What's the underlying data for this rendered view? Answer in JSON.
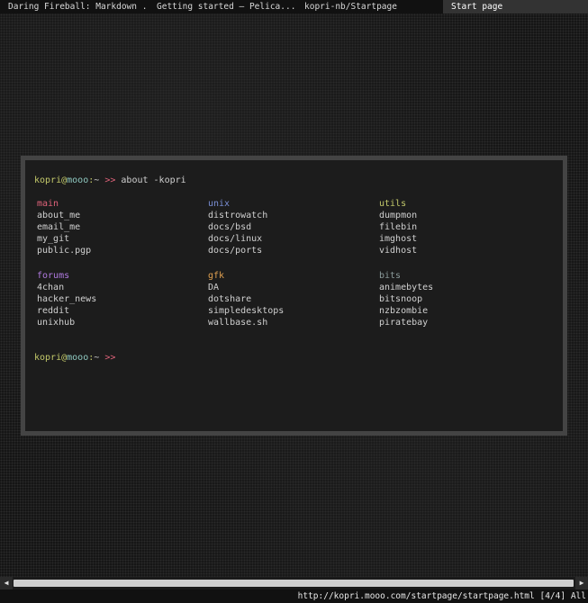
{
  "tabs": [
    {
      "label": "Daring Fireball: Markdown ..."
    },
    {
      "label": "Getting started — Pelica..."
    },
    {
      "label": "kopri-nb/Startpage"
    },
    {
      "label": "Start page"
    }
  ],
  "terminal": {
    "prompt": {
      "user": "kopri",
      "at": "@",
      "host": "mooo",
      "colon": ":",
      "dir": "~",
      "arrow": ">>"
    },
    "command": "about -kopri",
    "sections": [
      {
        "title": "main",
        "color": "#e0637a",
        "links": [
          "about_me",
          "email_me",
          "my_git",
          "public.pgp"
        ]
      },
      {
        "title": "unix",
        "color": "#7a8fd6",
        "links": [
          "distrowatch",
          "docs/bsd",
          "docs/linux",
          "docs/ports"
        ]
      },
      {
        "title": "utils",
        "color": "#c3c96a",
        "links": [
          "dumpmon",
          "filebin",
          "imghost",
          "vidhost"
        ]
      },
      {
        "title": "forums",
        "color": "#b07ae0",
        "links": [
          "4chan",
          "hacker_news",
          "reddit",
          "unixhub"
        ]
      },
      {
        "title": "gfk",
        "color": "#e0a050",
        "links": [
          "DA",
          "dotshare",
          "simpledesktops",
          "wallbase.sh"
        ]
      },
      {
        "title": "bits",
        "color": "#8a9a9a",
        "links": [
          "animebytes",
          "bitsnoop",
          "nzbzombie",
          "piratebay"
        ]
      }
    ]
  },
  "scrollbar": {
    "left_arrow": "◀",
    "right_arrow": "▶"
  },
  "status": {
    "url": "http://kopri.mooo.com/startpage/startpage.html",
    "position": "[4/4]",
    "scroll": "All"
  },
  "colors": {
    "background": "#141414",
    "terminal_bg": "#1c1c1c",
    "terminal_border": "#444444",
    "text": "#d0d0d0",
    "prompt_user": "#c3c96a",
    "prompt_host": "#8fc9c0",
    "prompt_arrow": "#e0637a"
  }
}
